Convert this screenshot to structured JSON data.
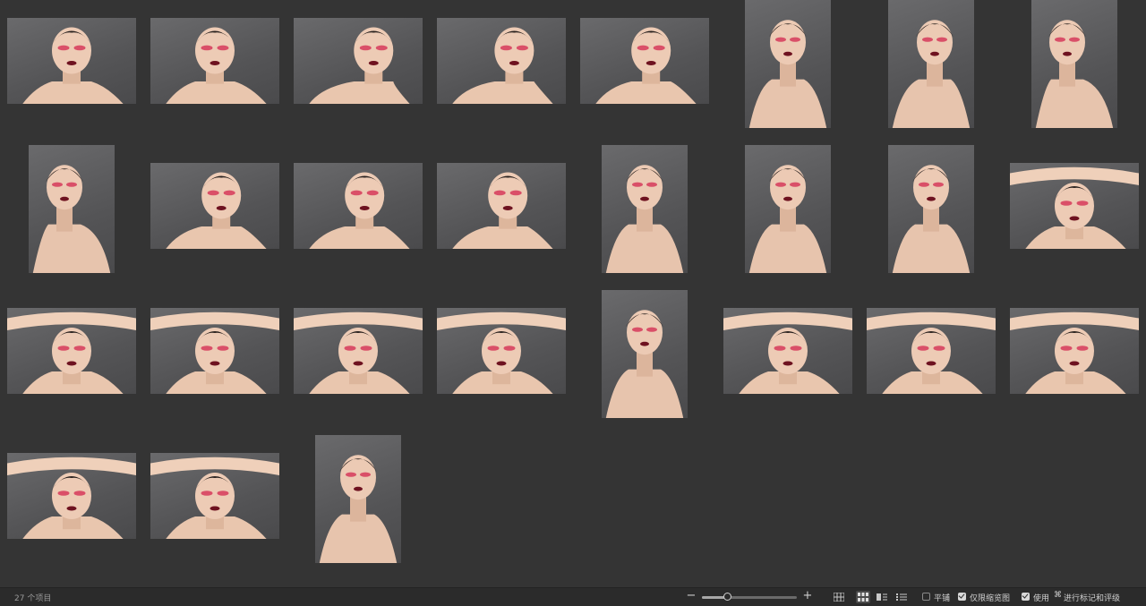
{
  "status": {
    "item_count": "27 个项目",
    "zoom_level": 0.27
  },
  "view_modes": [
    {
      "name": "grid-view-icon",
      "active": false
    },
    {
      "name": "thumbnail-view-icon",
      "active": true
    },
    {
      "name": "list-with-preview-icon",
      "active": false
    },
    {
      "name": "list-view-icon",
      "active": false
    }
  ],
  "options": {
    "tile_label": "平铺",
    "tile_checked": false,
    "thumbnails_only_label": "仅限缩览图",
    "thumbnails_only_checked": true,
    "use_label": "使用",
    "cmd_symbol": "⌘",
    "rating_label": "进行标记和评级",
    "rating_checked": true
  },
  "colors": {
    "background": "#343434",
    "statusbar": "#2b2b2b"
  },
  "thumbnails": [
    {
      "orientation": "landscape",
      "pose": "front"
    },
    {
      "orientation": "landscape",
      "pose": "front"
    },
    {
      "orientation": "landscape",
      "pose": "profile-right"
    },
    {
      "orientation": "landscape",
      "pose": "three-quarter-left"
    },
    {
      "orientation": "landscape",
      "pose": "three-quarter-right"
    },
    {
      "orientation": "portrait",
      "pose": "front"
    },
    {
      "orientation": "portrait",
      "pose": "tilted"
    },
    {
      "orientation": "portrait",
      "pose": "back"
    },
    {
      "orientation": "portrait",
      "pose": "back"
    },
    {
      "orientation": "landscape",
      "pose": "over-shoulder"
    },
    {
      "orientation": "landscape",
      "pose": "over-shoulder"
    },
    {
      "orientation": "landscape",
      "pose": "over-shoulder"
    },
    {
      "orientation": "portrait",
      "pose": "over-shoulder"
    },
    {
      "orientation": "portrait",
      "pose": "expression"
    },
    {
      "orientation": "portrait",
      "pose": "tongue"
    },
    {
      "orientation": "landscape",
      "pose": "arms-up"
    },
    {
      "orientation": "landscape",
      "pose": "arms-up"
    },
    {
      "orientation": "landscape",
      "pose": "arms-up"
    },
    {
      "orientation": "landscape",
      "pose": "arms-up"
    },
    {
      "orientation": "landscape",
      "pose": "arms-up"
    },
    {
      "orientation": "portrait",
      "pose": "hand-chin"
    },
    {
      "orientation": "landscape",
      "pose": "arms-up"
    },
    {
      "orientation": "landscape",
      "pose": "arms-up"
    },
    {
      "orientation": "landscape",
      "pose": "arms-up"
    },
    {
      "orientation": "landscape",
      "pose": "arms-up"
    },
    {
      "orientation": "landscape",
      "pose": "arms-up"
    },
    {
      "orientation": "portrait",
      "pose": "closeup"
    }
  ]
}
